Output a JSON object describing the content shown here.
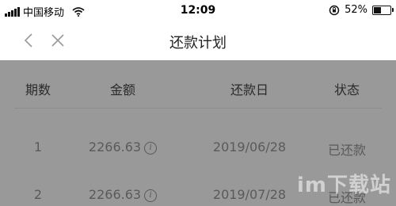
{
  "status_bar": {
    "carrier": "中国移动",
    "time": "12:09",
    "battery_percent": "52%",
    "battery_level": 0.52
  },
  "nav": {
    "title": "还款计划"
  },
  "table": {
    "columns": [
      "期数",
      "金额",
      "还款日",
      "状态"
    ],
    "rows": [
      {
        "period": "1",
        "amount": "2266.63",
        "date": "2019/06/28",
        "status": "已还款"
      },
      {
        "period": "2",
        "amount": "2266.63",
        "date": "2019/07/28",
        "status": "已还款"
      }
    ]
  },
  "watermark": {
    "text": "im下载站"
  }
}
